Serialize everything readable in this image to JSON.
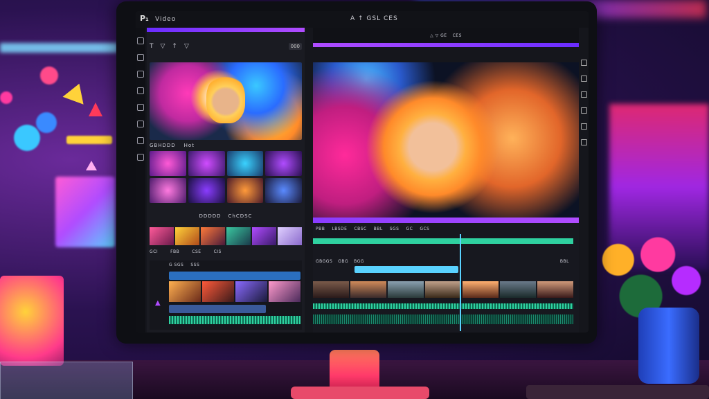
{
  "window": {
    "logo_glyph": "P₁",
    "app_name": "Video",
    "viewer_title": "A ↑ GSL  CES"
  },
  "left_panel": {
    "toolbar": {
      "icons": [
        "T",
        "▽",
        "↑",
        "▽"
      ],
      "badge": "000"
    },
    "source_labels": [
      "GBHDDD",
      "Hot"
    ],
    "browser_labels": [
      "DDDDD",
      "ChCDSC"
    ],
    "strip_labels": [
      "GCI",
      "FBB",
      "CSE",
      "CIS"
    ],
    "mini_timeline": {
      "labels": [
        "G SGS",
        "SSS"
      ]
    }
  },
  "viewer": {
    "header_labels": [
      "△ ▽ GE",
      "CES"
    ]
  },
  "timeline": {
    "ruler_labels": [
      "PBB",
      "LBSDE",
      "CBSC",
      "BBL",
      "SGS",
      "GC",
      "GCS"
    ],
    "track_labels": [
      "GBGGS",
      "GBG",
      "BGG",
      "BBL"
    ]
  },
  "colors": {
    "accent_purple": "#b04cff",
    "track_green": "#2fd1a0",
    "playhead_blue": "#5ad2ff",
    "panel_bg": "#1a1b22",
    "bezel": "#0e0f14"
  },
  "icons": {
    "left_toolbar": [
      "panel-icon",
      "grid-icon",
      "layers-icon",
      "move-icon",
      "crop-icon",
      "zoom-icon",
      "list-icon",
      "fx-icon"
    ],
    "right_rail": [
      "pin-icon",
      "grid-icon",
      "layers-icon",
      "audio-icon",
      "settings-icon",
      "clock-icon"
    ]
  }
}
